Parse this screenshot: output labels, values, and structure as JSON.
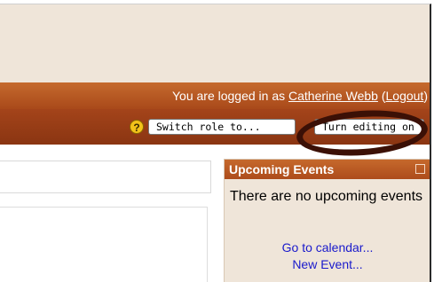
{
  "header": {
    "logged_in_prefix": "You are logged in as ",
    "user_name": "Catherine Webb",
    "logout_open": " (",
    "logout_label": "Logout",
    "logout_close": ")"
  },
  "nav": {
    "help_icon_glyph": "?",
    "switch_role_label": "Switch role to...",
    "turn_editing_label": "Turn editing on"
  },
  "upcoming_block": {
    "title": "Upcoming Events",
    "message": "There are no upcoming events",
    "links": [
      "Go to calendar...",
      "New Event..."
    ]
  },
  "colors": {
    "accent_orange": "#c56a2d",
    "accent_dark": "#8a3512",
    "block_bg": "#efe5d9",
    "annotation_ring": "#3b1006",
    "link_blue": "#1a1acc"
  },
  "icons": {
    "help": "help-icon",
    "hide": "hide-block-icon"
  }
}
